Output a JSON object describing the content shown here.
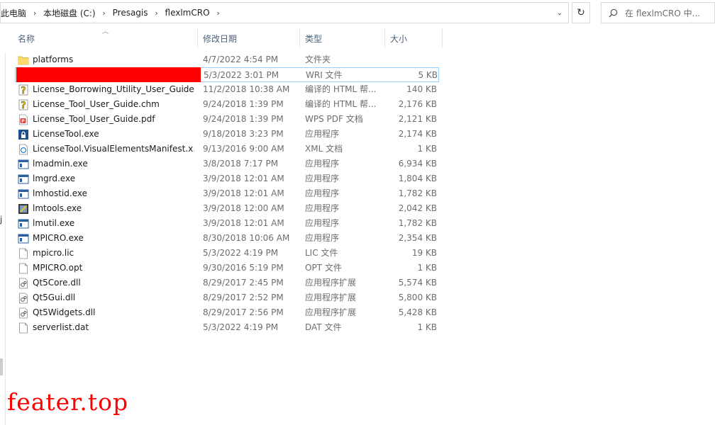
{
  "breadcrumb": [
    "此电脑",
    "本地磁盘 (C:)",
    "Presagis",
    "flexlmCRO"
  ],
  "search_placeholder": "在 flexlmCRO 中...",
  "columns": {
    "name": "名称",
    "date": "修改日期",
    "type": "类型",
    "size": "大小"
  },
  "left_pane_fragment": "j",
  "files": [
    {
      "name": "platforms",
      "date": "4/7/2022 4:54 PM",
      "type": "文件夹",
      "size": "",
      "icon": "folder-icon"
    },
    {
      "name": "",
      "date": "5/3/2022 3:01 PM",
      "type": "WRI 文件",
      "size": "5 KB",
      "icon": "redacted",
      "redacted": true,
      "selected": true
    },
    {
      "name": "License_Borrowing_Utility_User_Guide...",
      "date": "11/2/2018 10:38 AM",
      "type": "编译的 HTML 帮...",
      "size": "140 KB",
      "icon": "help-file-icon"
    },
    {
      "name": "License_Tool_User_Guide.chm",
      "date": "9/24/2018 1:39 PM",
      "type": "编译的 HTML 帮...",
      "size": "2,176 KB",
      "icon": "help-file-icon"
    },
    {
      "name": "License_Tool_User_Guide.pdf",
      "date": "9/24/2018 1:39 PM",
      "type": "WPS PDF 文档",
      "size": "2,121 KB",
      "icon": "pdf-icon"
    },
    {
      "name": "LicenseTool.exe",
      "date": "9/18/2018 3:23 PM",
      "type": "应用程序",
      "size": "2,174 KB",
      "icon": "lock-app-icon"
    },
    {
      "name": "LicenseTool.VisualElementsManifest.x...",
      "date": "9/13/2016 9:00 AM",
      "type": "XML 文档",
      "size": "1 KB",
      "icon": "xml-file-icon"
    },
    {
      "name": "lmadmin.exe",
      "date": "3/8/2018 7:17 PM",
      "type": "应用程序",
      "size": "6,934 KB",
      "icon": "exe-icon"
    },
    {
      "name": "lmgrd.exe",
      "date": "3/9/2018 12:01 AM",
      "type": "应用程序",
      "size": "1,804 KB",
      "icon": "exe-icon"
    },
    {
      "name": "lmhostid.exe",
      "date": "3/9/2018 12:01 AM",
      "type": "应用程序",
      "size": "1,782 KB",
      "icon": "exe-icon"
    },
    {
      "name": "lmtools.exe",
      "date": "3/9/2018 12:00 AM",
      "type": "应用程序",
      "size": "2,042 KB",
      "icon": "lmtools-icon"
    },
    {
      "name": "lmutil.exe",
      "date": "3/9/2018 12:01 AM",
      "type": "应用程序",
      "size": "1,782 KB",
      "icon": "exe-icon"
    },
    {
      "name": "MPICRO.exe",
      "date": "8/30/2018 10:06 AM",
      "type": "应用程序",
      "size": "2,354 KB",
      "icon": "exe-icon"
    },
    {
      "name": "mpicro.lic",
      "date": "5/3/2022 4:19 PM",
      "type": "LIC 文件",
      "size": "19 KB",
      "icon": "generic-file-icon"
    },
    {
      "name": "MPICRO.opt",
      "date": "9/30/2016 5:19 PM",
      "type": "OPT 文件",
      "size": "1 KB",
      "icon": "generic-file-icon"
    },
    {
      "name": "Qt5Core.dll",
      "date": "8/29/2017 2:45 PM",
      "type": "应用程序扩展",
      "size": "5,574 KB",
      "icon": "dll-icon"
    },
    {
      "name": "Qt5Gui.dll",
      "date": "8/29/2017 2:52 PM",
      "type": "应用程序扩展",
      "size": "5,800 KB",
      "icon": "dll-icon"
    },
    {
      "name": "Qt5Widgets.dll",
      "date": "8/29/2017 2:56 PM",
      "type": "应用程序扩展",
      "size": "5,428 KB",
      "icon": "dll-icon"
    },
    {
      "name": "serverlist.dat",
      "date": "5/3/2022 4:19 PM",
      "type": "DAT 文件",
      "size": "1 KB",
      "icon": "generic-file-icon"
    }
  ],
  "watermark": "feater.top",
  "colors": {
    "redaction": "#ff0000",
    "header_text": "#4c607a",
    "selection_border": "#99d1ff",
    "folder": "#f8d775"
  }
}
